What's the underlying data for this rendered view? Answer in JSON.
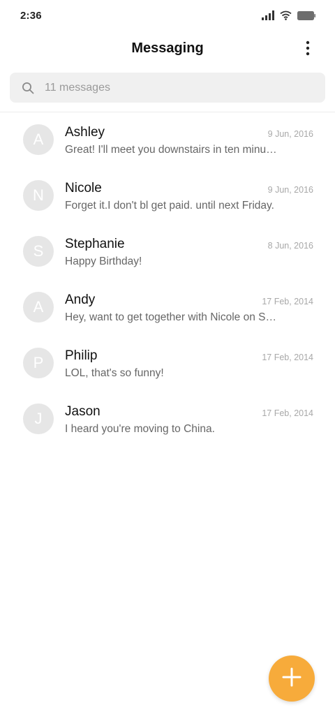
{
  "status_bar": {
    "time": "2:36",
    "icons": [
      "signal-icon",
      "wifi-icon",
      "battery-icon"
    ]
  },
  "app_bar": {
    "title": "Messaging",
    "menu_icon": "more-vertical-icon"
  },
  "search": {
    "placeholder": "11 messages",
    "value": "",
    "icon": "search-icon"
  },
  "conversations": [
    {
      "initial": "A",
      "name": "Ashley",
      "date": "9 Jun, 2016",
      "snippet": "Great! I'll meet you downstairs in ten minutes."
    },
    {
      "initial": "N",
      "name": "Nicole",
      "date": "9 Jun, 2016",
      "snippet": "Forget it.I don't bl get paid. until next Friday."
    },
    {
      "initial": "S",
      "name": "Stephanie",
      "date": "8 Jun, 2016",
      "snippet": "Happy Birthday!"
    },
    {
      "initial": "A",
      "name": "Andy",
      "date": "17 Feb, 2014",
      "snippet": "Hey, want to get together with Nicole on Saturday?"
    },
    {
      "initial": "P",
      "name": "Philip",
      "date": "17 Feb, 2014",
      "snippet": "LOL, that's so funny!"
    },
    {
      "initial": "J",
      "name": "Jason",
      "date": "17 Feb, 2014",
      "snippet": "I heard you're moving to China."
    }
  ],
  "fab": {
    "icon": "plus-icon"
  },
  "colors": {
    "accent": "#f7ab3b",
    "avatar_bg": "#e6e6e6",
    "search_bg": "#f0f0f0"
  }
}
